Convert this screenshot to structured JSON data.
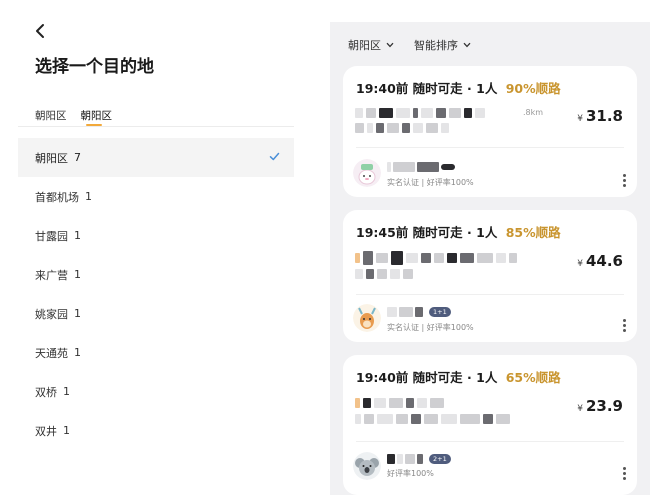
{
  "header": {
    "title": "选择一个目的地"
  },
  "tabs": [
    {
      "label": "朝阳区"
    },
    {
      "label": "朝阳区"
    }
  ],
  "areas": [
    {
      "name": "朝阳区",
      "count": "7"
    },
    {
      "name": "首都机场",
      "count": "1"
    },
    {
      "name": "甘露园",
      "count": "1"
    },
    {
      "name": "来广营",
      "count": "1"
    },
    {
      "name": "姚家园",
      "count": "1"
    },
    {
      "name": "天通苑",
      "count": "1"
    },
    {
      "name": "双桥",
      "count": "1"
    },
    {
      "name": "双井",
      "count": "1"
    }
  ],
  "filters": {
    "area": "朝阳区",
    "sort": "智能排序"
  },
  "rides": [
    {
      "time": "19:40前",
      "mode": "随时可走",
      "people": "1人",
      "match": "90%顺路",
      "price": "31.8",
      "currency": "¥",
      "distance": ".8km",
      "driver_sub": "实名认证 | 好评率100%"
    },
    {
      "time": "19:45前",
      "mode": "随时可走",
      "people": "1人",
      "match": "85%顺路",
      "price": "44.6",
      "currency": "¥",
      "badge": "1+1",
      "driver_sub": "实名认证 | 好评率100%"
    },
    {
      "time": "19:40前",
      "mode": "随时可走",
      "people": "1人",
      "match": "65%顺路",
      "price": "23.9",
      "currency": "¥",
      "badge": "2+1",
      "driver_sub": "好评率100%"
    }
  ],
  "colors": {
    "accent": "#c9952f",
    "tab_underline": "#f2a93b",
    "panel_bg": "#f1f1f3",
    "selected_bg": "#f4f4f4"
  }
}
